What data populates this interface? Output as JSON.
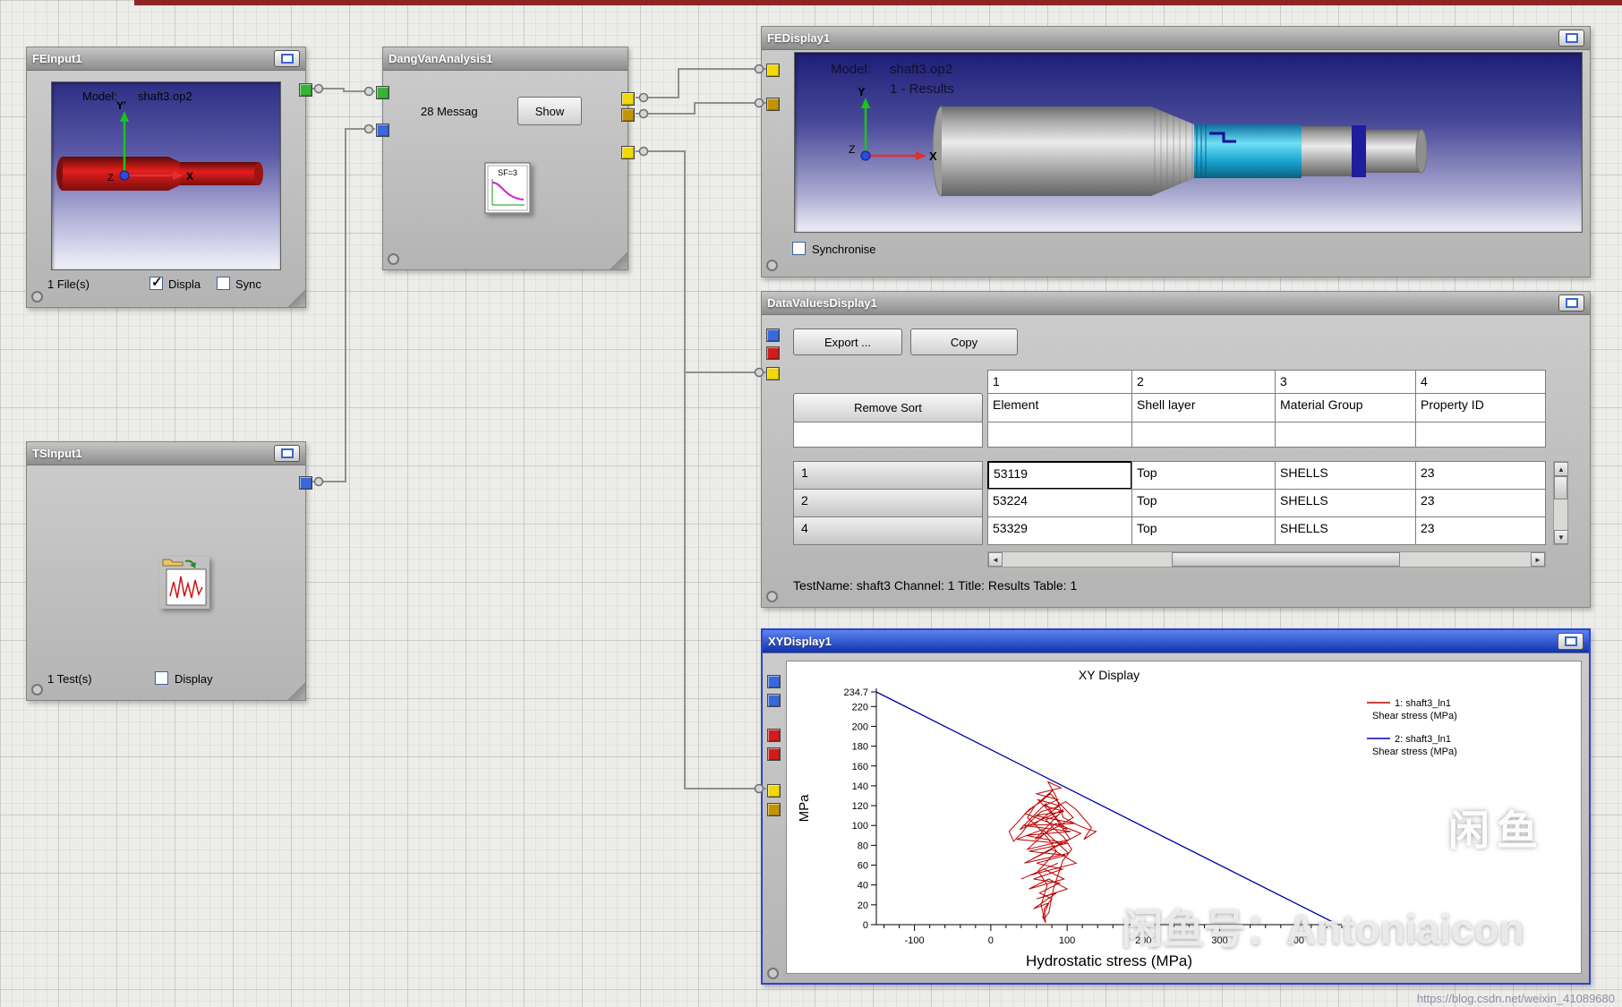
{
  "nodes": {
    "fe_input": {
      "title": "FEInput1",
      "viewport": {
        "model_label": "Model:",
        "model_value": "shaft3.op2",
        "axis_y": "Y'",
        "axis_x": "X",
        "axis_z": "Z"
      },
      "files_label": "1 File(s)",
      "display_label": "Displa",
      "sync_label": "Sync",
      "display_checked": true,
      "sync_checked": false
    },
    "dang_van": {
      "title": "DangVanAnalysis1",
      "messages_label": "28 Messag",
      "show_label": "Show",
      "icon_label": "SF=3"
    },
    "ts_input": {
      "title": "TSInput1",
      "tests_label": "1 Test(s)",
      "display_label": "Display",
      "display_checked": false
    },
    "fe_display": {
      "title": "FEDisplay1",
      "viewport": {
        "model_label": "Model:",
        "model_value": "shaft3.op2",
        "results_label": "1 - Results",
        "axis_y": "Y",
        "axis_x": "X",
        "axis_z": "Z"
      },
      "synchronise_label": "Synchronise",
      "synchronise_checked": false
    },
    "data_values": {
      "title": "DataValuesDisplay1",
      "export_label": "Export ...",
      "copy_label": "Copy",
      "remove_sort_label": "Remove Sort",
      "column_numbers": [
        "1",
        "2",
        "3",
        "4"
      ],
      "columns": [
        "Element",
        "Shell layer",
        "Material Group",
        "Property ID"
      ],
      "rows": [
        {
          "id": "1",
          "element": "53119",
          "shell_layer": "Top",
          "material_group": "SHELLS",
          "property_id": "23"
        },
        {
          "id": "2",
          "element": "53224",
          "shell_layer": "Top",
          "material_group": "SHELLS",
          "property_id": "23"
        },
        {
          "id": "4",
          "element": "53329",
          "shell_layer": "Top",
          "material_group": "SHELLS",
          "property_id": "23"
        }
      ],
      "status": "TestName: shaft3  Channel: 1  Title: Results  Table: 1"
    },
    "xy_display": {
      "title": "XYDisplay1"
    }
  },
  "icons": {
    "scroll_left": "◄",
    "scroll_right": "►",
    "scroll_up": "▲",
    "scroll_down": "▼"
  },
  "port_colors": {
    "green": "#38b438",
    "blue": "#3a68dc",
    "yellow": "#f0d80a",
    "gold": "#c49404",
    "red": "#d01c1c"
  },
  "chart_data": {
    "type": "line",
    "title": "XY Display",
    "xlabel": "Hydrostatic stress (MPa)",
    "ylabel": "MPa",
    "xlim": [
      -150,
      460
    ],
    "ylim": [
      0,
      234.7
    ],
    "x_major_ticks": [
      -100,
      0,
      100,
      200,
      300,
      400
    ],
    "x_minor_step": 20,
    "y_ticks": [
      0,
      20,
      40,
      60,
      80,
      100,
      120,
      140,
      160,
      180,
      200,
      220,
      234.7
    ],
    "legend_position": "right",
    "grid": false,
    "series": [
      {
        "name": "1: shaft3_ln1",
        "quantity": "Shear stress (MPa)",
        "color": "#bb0000",
        "width": 1,
        "points": [
          [
            55,
            100
          ],
          [
            90,
            120
          ],
          [
            62,
            126
          ],
          [
            100,
            96
          ],
          [
            45,
            112
          ],
          [
            78,
            132
          ],
          [
            108,
            108
          ],
          [
            58,
            86
          ],
          [
            95,
            116
          ],
          [
            38,
            96
          ],
          [
            72,
            122
          ],
          [
            104,
            86
          ],
          [
            48,
            76
          ],
          [
            85,
            102
          ],
          [
            118,
            92
          ],
          [
            54,
            66
          ],
          [
            92,
            82
          ],
          [
            34,
            86
          ],
          [
            68,
            96
          ],
          [
            102,
            72
          ],
          [
            44,
            62
          ],
          [
            80,
            76
          ],
          [
            112,
            62
          ],
          [
            52,
            50
          ],
          [
            88,
            62
          ],
          [
            40,
            46
          ],
          [
            70,
            56
          ],
          [
            96,
            46
          ],
          [
            50,
            36
          ],
          [
            76,
            46
          ],
          [
            100,
            36
          ],
          [
            60,
            26
          ],
          [
            86,
            32
          ],
          [
            56,
            16
          ],
          [
            76,
            22
          ],
          [
            68,
            8
          ],
          [
            72,
            2
          ],
          [
            70,
            16
          ],
          [
            80,
            26
          ],
          [
            64,
            32
          ],
          [
            90,
            42
          ],
          [
            56,
            46
          ],
          [
            94,
            56
          ],
          [
            60,
            62
          ],
          [
            98,
            70
          ],
          [
            50,
            74
          ],
          [
            100,
            82
          ],
          [
            46,
            90
          ],
          [
            105,
            94
          ],
          [
            42,
            100
          ],
          [
            110,
            102
          ],
          [
            58,
            110
          ],
          [
            96,
            114
          ],
          [
            70,
            120
          ],
          [
            88,
            126
          ],
          [
            60,
            132
          ],
          [
            92,
            138
          ],
          [
            75,
            144
          ],
          [
            85,
            130
          ],
          [
            95,
            108
          ],
          [
            115,
            100
          ],
          [
            128,
            96
          ],
          [
            138,
            94
          ],
          [
            122,
            86
          ],
          [
            132,
            98
          ],
          [
            112,
            116
          ],
          [
            98,
            124
          ],
          [
            84,
            118
          ],
          [
            66,
            114
          ],
          [
            52,
            104
          ],
          [
            40,
            92
          ],
          [
            30,
            84
          ],
          [
            24,
            94
          ],
          [
            36,
            104
          ],
          [
            50,
            116
          ],
          [
            66,
            124
          ],
          [
            82,
            136
          ],
          [
            70,
            128
          ],
          [
            58,
            120
          ],
          [
            48,
            108
          ],
          [
            62,
            98
          ],
          [
            74,
            88
          ],
          [
            86,
            74
          ],
          [
            74,
            64
          ],
          [
            62,
            54
          ],
          [
            74,
            40
          ],
          [
            66,
            20
          ],
          [
            70,
            6
          ],
          [
            76,
            12
          ],
          [
            82,
            36
          ],
          [
            94,
            64
          ],
          [
            106,
            76
          ],
          [
            96,
            88
          ],
          [
            84,
            96
          ],
          [
            72,
            106
          ],
          [
            88,
            110
          ]
        ]
      },
      {
        "name": "2: shaft3_ln1",
        "quantity": "Shear stress (MPa)",
        "color": "#0000aa",
        "width": 1.3,
        "points": [
          [
            -150,
            234.7
          ],
          [
            455,
            0
          ]
        ]
      }
    ]
  },
  "watermark": {
    "logo_text": "闲鱼",
    "owner_text": "闲鱼号：Antoniaicon",
    "url_text": "https://blog.csdn.net/weixin_41089680"
  }
}
